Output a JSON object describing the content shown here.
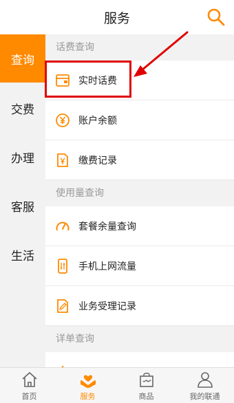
{
  "header": {
    "title": "服务"
  },
  "sidebar": {
    "items": [
      "查询",
      "交费",
      "办理",
      "客服",
      "生活"
    ]
  },
  "content": {
    "sections": [
      {
        "title": "话费查询",
        "items": [
          "实时话费",
          "账户余额",
          "缴费记录"
        ]
      },
      {
        "title": "使用量查询",
        "items": [
          "套餐余量查询",
          "手机上网流量",
          "业务受理记录"
        ]
      },
      {
        "title": "详单查询",
        "items": []
      }
    ]
  },
  "tabbar": {
    "items": [
      "首页",
      "服务",
      "商品",
      "我的联通"
    ]
  },
  "colors": {
    "accent": "#ff8a00",
    "highlight": "#e00000",
    "panel": "#f2f2f2"
  }
}
